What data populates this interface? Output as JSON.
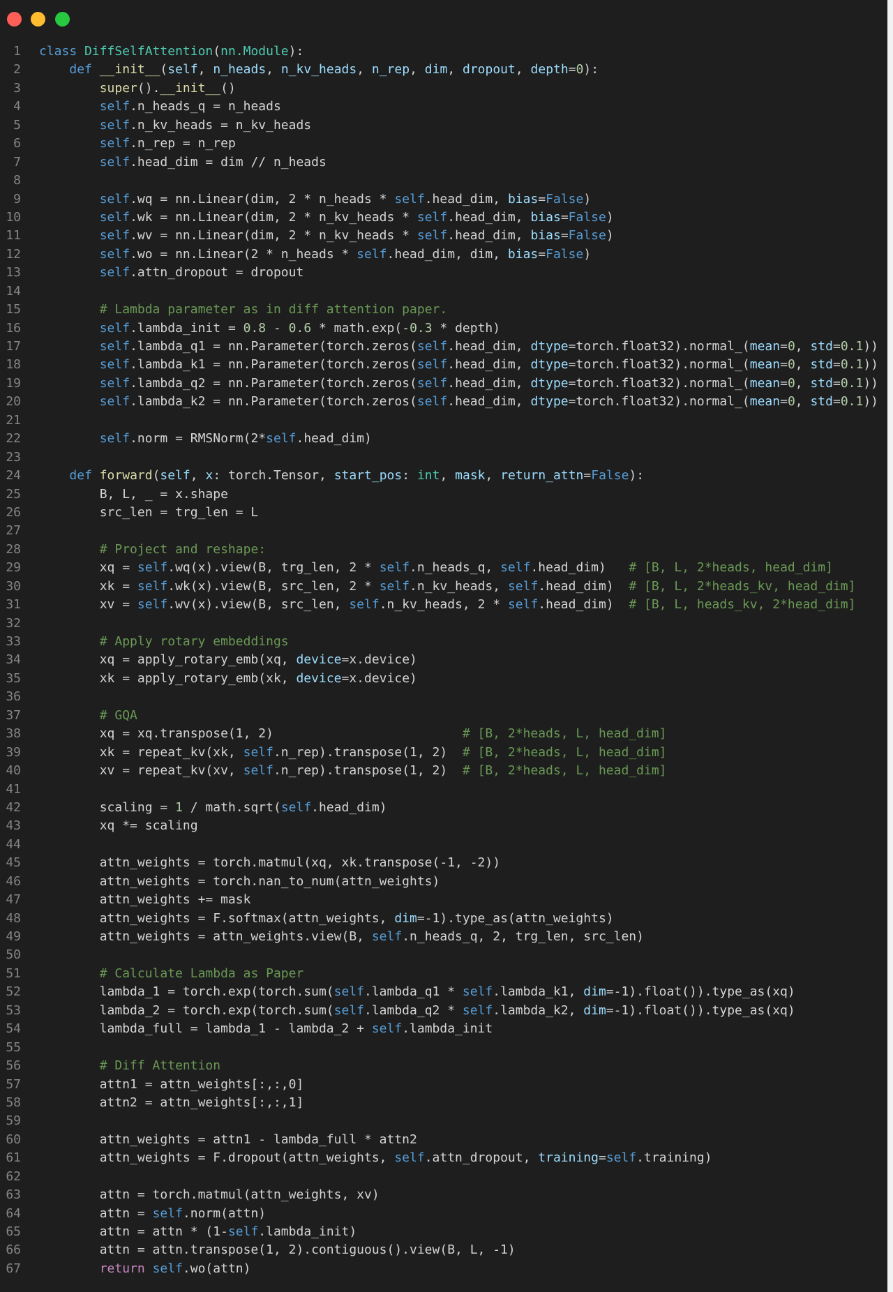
{
  "window": {
    "controls": [
      {
        "name": "close-window-button",
        "color": "#ff5f57"
      },
      {
        "name": "minimize-window-button",
        "color": "#febc2e"
      },
      {
        "name": "maximize-window-button",
        "color": "#28c840"
      }
    ]
  },
  "theme": {
    "background": "#1e1e1e",
    "line_number": "#858585",
    "keyword": "#569cd6",
    "class_name": "#4ec9b0",
    "function": "#dcdcaa",
    "variable": "#9cdcfe",
    "number": "#b5cea8",
    "comment": "#6a9955",
    "control_keyword": "#c586c0",
    "text": "#d4d4d4"
  },
  "code": {
    "lines": [
      [
        [
          "kw",
          "class "
        ],
        [
          "cls",
          "DiffSelfAttention"
        ],
        [
          "txt",
          "("
        ],
        [
          "cls",
          "nn.Module"
        ],
        [
          "txt",
          "):"
        ]
      ],
      [
        [
          "txt",
          "    "
        ],
        [
          "kw",
          "def "
        ],
        [
          "fn",
          "__init__"
        ],
        [
          "txt",
          "("
        ],
        [
          "var",
          "self"
        ],
        [
          "txt",
          ", "
        ],
        [
          "var",
          "n_heads"
        ],
        [
          "txt",
          ", "
        ],
        [
          "var",
          "n_kv_heads"
        ],
        [
          "txt",
          ", "
        ],
        [
          "var",
          "n_rep"
        ],
        [
          "txt",
          ", "
        ],
        [
          "var",
          "dim"
        ],
        [
          "txt",
          ", "
        ],
        [
          "var",
          "dropout"
        ],
        [
          "txt",
          ", "
        ],
        [
          "var",
          "depth"
        ],
        [
          "txt",
          "="
        ],
        [
          "num",
          "0"
        ],
        [
          "txt",
          "):"
        ]
      ],
      [
        [
          "txt",
          "        "
        ],
        [
          "fn",
          "super"
        ],
        [
          "txt",
          "()."
        ],
        [
          "fn",
          "__init__"
        ],
        [
          "txt",
          "()"
        ]
      ],
      [
        [
          "txt",
          "        "
        ],
        [
          "kw",
          "self"
        ],
        [
          "txt",
          ".n_heads_q = n_heads"
        ]
      ],
      [
        [
          "txt",
          "        "
        ],
        [
          "kw",
          "self"
        ],
        [
          "txt",
          ".n_kv_heads = n_kv_heads"
        ]
      ],
      [
        [
          "txt",
          "        "
        ],
        [
          "kw",
          "self"
        ],
        [
          "txt",
          ".n_rep = n_rep"
        ]
      ],
      [
        [
          "txt",
          "        "
        ],
        [
          "kw",
          "self"
        ],
        [
          "txt",
          ".head_dim = dim // n_heads"
        ]
      ],
      [],
      [
        [
          "txt",
          "        "
        ],
        [
          "kw",
          "self"
        ],
        [
          "txt",
          ".wq = nn.Linear(dim, 2 * n_heads * "
        ],
        [
          "kw",
          "self"
        ],
        [
          "txt",
          ".head_dim, "
        ],
        [
          "var",
          "bias"
        ],
        [
          "txt",
          "="
        ],
        [
          "kw",
          "False"
        ],
        [
          "txt",
          ")"
        ]
      ],
      [
        [
          "txt",
          "        "
        ],
        [
          "kw",
          "self"
        ],
        [
          "txt",
          ".wk = nn.Linear(dim, 2 * n_kv_heads * "
        ],
        [
          "kw",
          "self"
        ],
        [
          "txt",
          ".head_dim, "
        ],
        [
          "var",
          "bias"
        ],
        [
          "txt",
          "="
        ],
        [
          "kw",
          "False"
        ],
        [
          "txt",
          ")"
        ]
      ],
      [
        [
          "txt",
          "        "
        ],
        [
          "kw",
          "self"
        ],
        [
          "txt",
          ".wv = nn.Linear(dim, 2 * n_kv_heads * "
        ],
        [
          "kw",
          "self"
        ],
        [
          "txt",
          ".head_dim, "
        ],
        [
          "var",
          "bias"
        ],
        [
          "txt",
          "="
        ],
        [
          "kw",
          "False"
        ],
        [
          "txt",
          ")"
        ]
      ],
      [
        [
          "txt",
          "        "
        ],
        [
          "kw",
          "self"
        ],
        [
          "txt",
          ".wo = nn.Linear(2 * n_heads * "
        ],
        [
          "kw",
          "self"
        ],
        [
          "txt",
          ".head_dim, dim, "
        ],
        [
          "var",
          "bias"
        ],
        [
          "txt",
          "="
        ],
        [
          "kw",
          "False"
        ],
        [
          "txt",
          ")"
        ]
      ],
      [
        [
          "txt",
          "        "
        ],
        [
          "kw",
          "self"
        ],
        [
          "txt",
          ".attn_dropout = dropout"
        ]
      ],
      [],
      [
        [
          "txt",
          "        "
        ],
        [
          "cmt",
          "# Lambda parameter as in diff attention paper."
        ]
      ],
      [
        [
          "txt",
          "        "
        ],
        [
          "kw",
          "self"
        ],
        [
          "txt",
          ".lambda_init = "
        ],
        [
          "num",
          "0.8"
        ],
        [
          "txt",
          " - "
        ],
        [
          "num",
          "0.6"
        ],
        [
          "txt",
          " * math.exp(-"
        ],
        [
          "num",
          "0.3"
        ],
        [
          "txt",
          " * depth)"
        ]
      ],
      [
        [
          "txt",
          "        "
        ],
        [
          "kw",
          "self"
        ],
        [
          "txt",
          ".lambda_q1 = nn.Parameter(torch.zeros("
        ],
        [
          "kw",
          "self"
        ],
        [
          "txt",
          ".head_dim, "
        ],
        [
          "var",
          "dtype"
        ],
        [
          "txt",
          "=torch.float32).normal_("
        ],
        [
          "var",
          "mean"
        ],
        [
          "txt",
          "="
        ],
        [
          "num",
          "0"
        ],
        [
          "txt",
          ", "
        ],
        [
          "var",
          "std"
        ],
        [
          "txt",
          "="
        ],
        [
          "num",
          "0.1"
        ],
        [
          "txt",
          "))"
        ]
      ],
      [
        [
          "txt",
          "        "
        ],
        [
          "kw",
          "self"
        ],
        [
          "txt",
          ".lambda_k1 = nn.Parameter(torch.zeros("
        ],
        [
          "kw",
          "self"
        ],
        [
          "txt",
          ".head_dim, "
        ],
        [
          "var",
          "dtype"
        ],
        [
          "txt",
          "=torch.float32).normal_("
        ],
        [
          "var",
          "mean"
        ],
        [
          "txt",
          "="
        ],
        [
          "num",
          "0"
        ],
        [
          "txt",
          ", "
        ],
        [
          "var",
          "std"
        ],
        [
          "txt",
          "="
        ],
        [
          "num",
          "0.1"
        ],
        [
          "txt",
          "))"
        ]
      ],
      [
        [
          "txt",
          "        "
        ],
        [
          "kw",
          "self"
        ],
        [
          "txt",
          ".lambda_q2 = nn.Parameter(torch.zeros("
        ],
        [
          "kw",
          "self"
        ],
        [
          "txt",
          ".head_dim, "
        ],
        [
          "var",
          "dtype"
        ],
        [
          "txt",
          "=torch.float32).normal_("
        ],
        [
          "var",
          "mean"
        ],
        [
          "txt",
          "="
        ],
        [
          "num",
          "0"
        ],
        [
          "txt",
          ", "
        ],
        [
          "var",
          "std"
        ],
        [
          "txt",
          "="
        ],
        [
          "num",
          "0.1"
        ],
        [
          "txt",
          "))"
        ]
      ],
      [
        [
          "txt",
          "        "
        ],
        [
          "kw",
          "self"
        ],
        [
          "txt",
          ".lambda_k2 = nn.Parameter(torch.zeros("
        ],
        [
          "kw",
          "self"
        ],
        [
          "txt",
          ".head_dim, "
        ],
        [
          "var",
          "dtype"
        ],
        [
          "txt",
          "=torch.float32).normal_("
        ],
        [
          "var",
          "mean"
        ],
        [
          "txt",
          "="
        ],
        [
          "num",
          "0"
        ],
        [
          "txt",
          ", "
        ],
        [
          "var",
          "std"
        ],
        [
          "txt",
          "="
        ],
        [
          "num",
          "0.1"
        ],
        [
          "txt",
          "))"
        ]
      ],
      [],
      [
        [
          "txt",
          "        "
        ],
        [
          "kw",
          "self"
        ],
        [
          "txt",
          ".norm = RMSNorm(2*"
        ],
        [
          "kw",
          "self"
        ],
        [
          "txt",
          ".head_dim)"
        ]
      ],
      [],
      [
        [
          "txt",
          "    "
        ],
        [
          "kw",
          "def "
        ],
        [
          "fn",
          "forward"
        ],
        [
          "txt",
          "("
        ],
        [
          "var",
          "self"
        ],
        [
          "txt",
          ", "
        ],
        [
          "var",
          "x"
        ],
        [
          "txt",
          ": torch.Tensor, "
        ],
        [
          "var",
          "start_pos"
        ],
        [
          "txt",
          ": "
        ],
        [
          "cls",
          "int"
        ],
        [
          "txt",
          ", "
        ],
        [
          "var",
          "mask"
        ],
        [
          "txt",
          ", "
        ],
        [
          "var",
          "return_attn"
        ],
        [
          "txt",
          "="
        ],
        [
          "kw",
          "False"
        ],
        [
          "txt",
          "):"
        ]
      ],
      [
        [
          "txt",
          "        B, L, _ = x.shape"
        ]
      ],
      [
        [
          "txt",
          "        src_len = trg_len = L"
        ]
      ],
      [],
      [
        [
          "txt",
          "        "
        ],
        [
          "cmt",
          "# Project and reshape:"
        ]
      ],
      [
        [
          "txt",
          "        xq = "
        ],
        [
          "kw",
          "self"
        ],
        [
          "txt",
          ".wq(x).view(B, trg_len, 2 * "
        ],
        [
          "kw",
          "self"
        ],
        [
          "txt",
          ".n_heads_q, "
        ],
        [
          "kw",
          "self"
        ],
        [
          "txt",
          ".head_dim)   "
        ],
        [
          "cmt",
          "# [B, L, 2*heads, head_dim]"
        ]
      ],
      [
        [
          "txt",
          "        xk = "
        ],
        [
          "kw",
          "self"
        ],
        [
          "txt",
          ".wk(x).view(B, src_len, 2 * "
        ],
        [
          "kw",
          "self"
        ],
        [
          "txt",
          ".n_kv_heads, "
        ],
        [
          "kw",
          "self"
        ],
        [
          "txt",
          ".head_dim)  "
        ],
        [
          "cmt",
          "# [B, L, 2*heads_kv, head_dim]"
        ]
      ],
      [
        [
          "txt",
          "        xv = "
        ],
        [
          "kw",
          "self"
        ],
        [
          "txt",
          ".wv(x).view(B, src_len, "
        ],
        [
          "kw",
          "self"
        ],
        [
          "txt",
          ".n_kv_heads, 2 * "
        ],
        [
          "kw",
          "self"
        ],
        [
          "txt",
          ".head_dim)  "
        ],
        [
          "cmt",
          "# [B, L, heads_kv, 2*head_dim]"
        ]
      ],
      [],
      [
        [
          "txt",
          "        "
        ],
        [
          "cmt",
          "# Apply rotary embeddings"
        ]
      ],
      [
        [
          "txt",
          "        xq = apply_rotary_emb(xq, "
        ],
        [
          "var",
          "device"
        ],
        [
          "txt",
          "=x.device)"
        ]
      ],
      [
        [
          "txt",
          "        xk = apply_rotary_emb(xk, "
        ],
        [
          "var",
          "device"
        ],
        [
          "txt",
          "=x.device)"
        ]
      ],
      [],
      [
        [
          "txt",
          "        "
        ],
        [
          "cmt",
          "# GQA"
        ]
      ],
      [
        [
          "txt",
          "        xq = xq.transpose(1, 2)                         "
        ],
        [
          "cmt",
          "# [B, 2*heads, L, head_dim]"
        ]
      ],
      [
        [
          "txt",
          "        xk = repeat_kv(xk, "
        ],
        [
          "kw",
          "self"
        ],
        [
          "txt",
          ".n_rep).transpose(1, 2)  "
        ],
        [
          "cmt",
          "# [B, 2*heads, L, head_dim]"
        ]
      ],
      [
        [
          "txt",
          "        xv = repeat_kv(xv, "
        ],
        [
          "kw",
          "self"
        ],
        [
          "txt",
          ".n_rep).transpose(1, 2)  "
        ],
        [
          "cmt",
          "# [B, 2*heads, L, head_dim]"
        ]
      ],
      [],
      [
        [
          "txt",
          "        scaling = "
        ],
        [
          "num",
          "1"
        ],
        [
          "txt",
          " / math.sqrt("
        ],
        [
          "kw",
          "self"
        ],
        [
          "txt",
          ".head_dim)"
        ]
      ],
      [
        [
          "txt",
          "        xq *= scaling"
        ]
      ],
      [],
      [
        [
          "txt",
          "        attn_weights = torch.matmul(xq, xk.transpose(-1, -2))"
        ]
      ],
      [
        [
          "txt",
          "        attn_weights = torch.nan_to_num(attn_weights)"
        ]
      ],
      [
        [
          "txt",
          "        attn_weights += mask"
        ]
      ],
      [
        [
          "txt",
          "        attn_weights = F.softmax(attn_weights, "
        ],
        [
          "var",
          "dim"
        ],
        [
          "txt",
          "=-1).type_as(attn_weights)"
        ]
      ],
      [
        [
          "txt",
          "        attn_weights = attn_weights.view(B, "
        ],
        [
          "kw",
          "self"
        ],
        [
          "txt",
          ".n_heads_q, 2, trg_len, src_len)"
        ]
      ],
      [],
      [
        [
          "txt",
          "        "
        ],
        [
          "cmt",
          "# Calculate Lambda as Paper"
        ]
      ],
      [
        [
          "txt",
          "        lambda_1 = torch.exp(torch.sum("
        ],
        [
          "kw",
          "self"
        ],
        [
          "txt",
          ".lambda_q1 * "
        ],
        [
          "kw",
          "self"
        ],
        [
          "txt",
          ".lambda_k1, "
        ],
        [
          "var",
          "dim"
        ],
        [
          "txt",
          "=-1).float()).type_as(xq)"
        ]
      ],
      [
        [
          "txt",
          "        lambda_2 = torch.exp(torch.sum("
        ],
        [
          "kw",
          "self"
        ],
        [
          "txt",
          ".lambda_q2 * "
        ],
        [
          "kw",
          "self"
        ],
        [
          "txt",
          ".lambda_k2, "
        ],
        [
          "var",
          "dim"
        ],
        [
          "txt",
          "=-1).float()).type_as(xq)"
        ]
      ],
      [
        [
          "txt",
          "        lambda_full = lambda_1 - lambda_2 + "
        ],
        [
          "kw",
          "self"
        ],
        [
          "txt",
          ".lambda_init"
        ]
      ],
      [],
      [
        [
          "txt",
          "        "
        ],
        [
          "cmt",
          "# Diff Attention"
        ]
      ],
      [
        [
          "txt",
          "        attn1 = attn_weights[:,:,0]"
        ]
      ],
      [
        [
          "txt",
          "        attn2 = attn_weights[:,:,1]"
        ]
      ],
      [],
      [
        [
          "txt",
          "        attn_weights = attn1 - lambda_full * attn2"
        ]
      ],
      [
        [
          "txt",
          "        attn_weights = F.dropout(attn_weights, "
        ],
        [
          "kw",
          "self"
        ],
        [
          "txt",
          ".attn_dropout, "
        ],
        [
          "var",
          "training"
        ],
        [
          "txt",
          "="
        ],
        [
          "kw",
          "self"
        ],
        [
          "txt",
          ".training)"
        ]
      ],
      [],
      [
        [
          "txt",
          "        attn = torch.matmul(attn_weights, xv)"
        ]
      ],
      [
        [
          "txt",
          "        attn = "
        ],
        [
          "kw",
          "self"
        ],
        [
          "txt",
          ".norm(attn)"
        ]
      ],
      [
        [
          "txt",
          "        attn = attn * (1-"
        ],
        [
          "kw",
          "self"
        ],
        [
          "txt",
          ".lambda_init)"
        ]
      ],
      [
        [
          "txt",
          "        attn = attn.transpose(1, 2).contiguous().view(B, L, -1)"
        ]
      ],
      [
        [
          "txt",
          "        "
        ],
        [
          "ret",
          "return "
        ],
        [
          "kw",
          "self"
        ],
        [
          "txt",
          ".wo(attn)"
        ]
      ]
    ]
  }
}
